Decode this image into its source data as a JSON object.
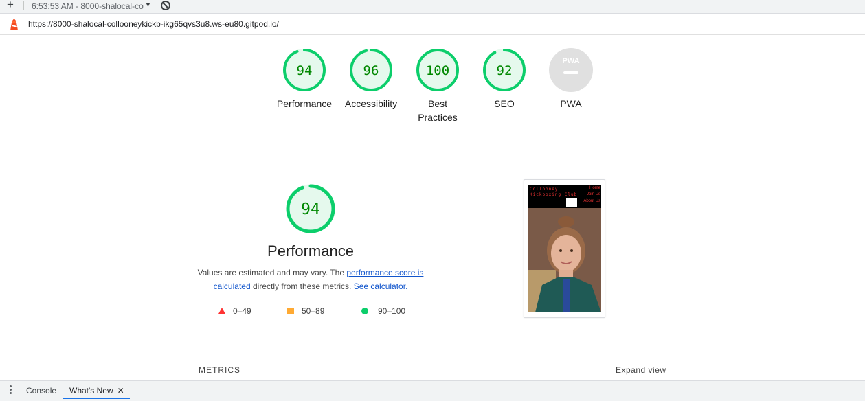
{
  "tabbar": {
    "plus": "+",
    "session": "6:53:53 AM - 8000-shalocal-co",
    "caret": "▼"
  },
  "urlbar": {
    "url": "https://8000-shalocal-collooneykickb-ikg65qvs3u8.ws-eu80.gitpod.io/"
  },
  "gauges": [
    {
      "score": "94",
      "label": "Performance",
      "fraction": 0.94
    },
    {
      "score": "96",
      "label": "Accessibility",
      "fraction": 0.96
    },
    {
      "score": "100",
      "label": "Best Practices",
      "fraction": 1.0
    },
    {
      "score": "92",
      "label": "SEO",
      "fraction": 0.92
    },
    {
      "score": "",
      "label": "PWA",
      "badge": "PWA"
    }
  ],
  "performance": {
    "score": "94",
    "fraction": 0.94,
    "title": "Performance",
    "desc_pre": "Values are estimated and may vary. The ",
    "link1": "performance score is calculated",
    "desc_mid": " directly from these metrics. ",
    "link2": "See calculator."
  },
  "legend": [
    {
      "icon": "triangle-icon",
      "range": "0–49",
      "color": "#ff3333"
    },
    {
      "icon": "square-icon",
      "range": "50–89",
      "color": "#ffaa33"
    },
    {
      "icon": "circle-icon",
      "range": "90–100",
      "color": "#0cce6b"
    }
  ],
  "screenshot": {
    "site_title": "Collooney Kickboxing Club",
    "nav": [
      "Home",
      "Join Us",
      "About Us"
    ]
  },
  "metrics_label": "METRICS",
  "expand_label": "Expand view",
  "drawer": {
    "tab1": "Console",
    "tab2": "What's New",
    "close": "✕"
  },
  "colors": {
    "pass": "#0cce6b",
    "pass_fill": "#e5f9ed",
    "pass_text": "#008800"
  }
}
